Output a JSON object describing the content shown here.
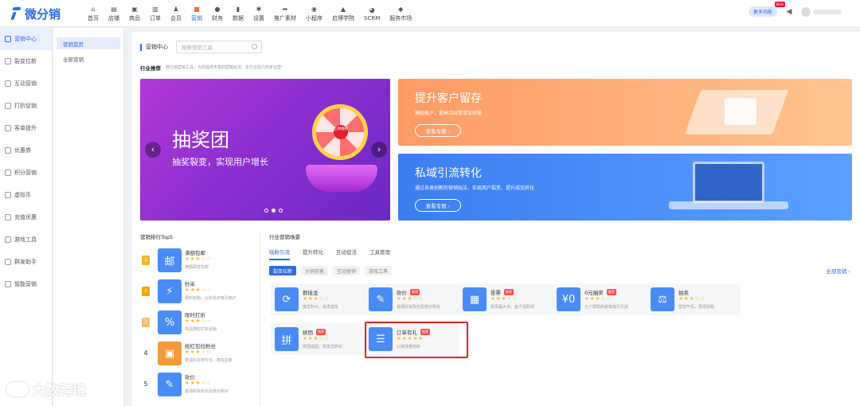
{
  "brand": {
    "logo_text": "微分销"
  },
  "top_nav": [
    {
      "label": "首页",
      "icon": "home-icon",
      "glyph": "⌂"
    },
    {
      "label": "店铺",
      "icon": "store-icon",
      "glyph": "▤"
    },
    {
      "label": "商品",
      "icon": "goods-icon",
      "glyph": "▣"
    },
    {
      "label": "订单",
      "icon": "order-icon",
      "glyph": "▥"
    },
    {
      "label": "会员",
      "icon": "member-icon",
      "glyph": "♟"
    },
    {
      "label": "营销",
      "icon": "marketing-icon",
      "glyph": "■",
      "active": true
    },
    {
      "label": "财务",
      "icon": "finance-icon",
      "glyph": "●"
    },
    {
      "label": "数据",
      "icon": "data-icon",
      "glyph": "▮"
    },
    {
      "label": "设置",
      "icon": "settings-icon",
      "glyph": "✱"
    },
    {
      "label": "推广素材",
      "icon": "share-icon",
      "glyph": "➦"
    },
    {
      "label": "小程序",
      "icon": "miniapp-icon",
      "glyph": "◉"
    },
    {
      "label": "启博学院",
      "icon": "academy-icon",
      "glyph": "▲"
    },
    {
      "label": "SCRM",
      "icon": "scrm-icon",
      "glyph": "◕"
    },
    {
      "label": "服务市场",
      "icon": "service-market-icon",
      "glyph": "◆"
    }
  ],
  "top_right": {
    "more_label": "更多功能",
    "new_badge": "NEW"
  },
  "sidebar": [
    {
      "label": "营销中心",
      "active": true
    },
    {
      "label": "裂变拉新"
    },
    {
      "label": "互动营销"
    },
    {
      "label": "打折促销"
    },
    {
      "label": "客单提升"
    },
    {
      "label": "优惠券"
    },
    {
      "label": "积分营销"
    },
    {
      "label": "虚拟币"
    },
    {
      "label": "充值优惠"
    },
    {
      "label": "游戏工具"
    },
    {
      "label": "群发助手"
    },
    {
      "label": "智能营销"
    }
  ],
  "subnav": [
    {
      "label": "营销首页",
      "active": true
    },
    {
      "label": "全部营销"
    }
  ],
  "header": {
    "title": "营销中心",
    "search_placeholder": "搜索营销工具"
  },
  "recommend": {
    "title": "行业推荐",
    "subtitle": "微分销营销工具，为您提供丰富的营销玩法，全方位助力商家运营!"
  },
  "banner_main": {
    "title": "抽奖团",
    "subtitle": "抽奖裂变，实现用户增长",
    "wheel_text": "立即抽奖"
  },
  "banner_r1": {
    "title": "提升客户留存",
    "subtitle": "激励客户，提高活跃度增加销量",
    "button": "查看专题 ›"
  },
  "banner_r2": {
    "title": "私域引流转化",
    "subtitle": "通过各类创新的营销玩法，实现用户裂变，提升成交转化",
    "button": "查看专题 ›"
  },
  "ranking": {
    "title": "营销排行Top5",
    "items": [
      {
        "rank": "1",
        "name": "满额包邮",
        "stars": "★★★☆☆",
        "desc": "满额即享包邮",
        "icon": "邮"
      },
      {
        "rank": "2",
        "name": "秒杀",
        "stars": "★★★☆☆",
        "desc": "限时抢购，以秒杀价吸引用户",
        "icon": "⚡"
      },
      {
        "rank": "3",
        "name": "限时打折",
        "stars": "★★★☆☆",
        "desc": "商品限时打折促销",
        "icon": "%"
      },
      {
        "rank": "4",
        "name": "抢红包拉粉丝",
        "stars": "★★★☆☆",
        "desc": "邀请好友抢红包，疯狂拉新",
        "icon": "▣"
      },
      {
        "rank": "5",
        "name": "砍价",
        "stars": "★★★☆☆",
        "desc": "邀请好友砍价后低价购买",
        "icon": "✎"
      }
    ]
  },
  "scenes": {
    "title": "行业营销场景",
    "tabs": [
      "吸粉引流",
      "提升转化",
      "互动促活",
      "工具管理"
    ],
    "chips": [
      "裂变拉新",
      "分销获客",
      "互动营销",
      "游戏工具"
    ],
    "all_link": "全部营销 ›",
    "cards": [
      {
        "name": "群接龙",
        "hot": "",
        "stars": "★★★☆☆",
        "desc": "接龙购买，激发成单",
        "icon": "⟳"
      },
      {
        "name": "砍价",
        "hot": "推荐",
        "stars": "★★★☆☆",
        "desc": "邀请好友砍价后低价购买",
        "icon": "✎"
      },
      {
        "name": "投票",
        "hot": "推荐",
        "stars": "★★★☆☆",
        "desc": "投票赢大奖，客户活跃高",
        "icon": "▦"
      },
      {
        "name": "0元抽奖",
        "hot": "推荐",
        "stars": "★★★☆☆",
        "desc": "为了帮助商家来吸引引流",
        "icon": "¥0"
      },
      {
        "name": "拍卖",
        "hot": "",
        "stars": "★★★☆☆",
        "desc": "营造气氛，围观拍租",
        "icon": "⚖"
      },
      {
        "name": "拼团",
        "hot": "推荐",
        "stars": "★★★☆☆",
        "desc": "拼团成团，裂变式转化",
        "icon": "拼"
      },
      {
        "name": "订单有礼",
        "hot": "推荐",
        "stars": "★★★★★",
        "desc": "公域流量拓新",
        "icon": "☰"
      }
    ]
  },
  "watermark": {
    "text": "大数跨境"
  },
  "colors": {
    "primary": "#2f6bdb",
    "highlight": "#e0211c",
    "banner_main": "#8a2ed0",
    "banner_r1": "#ff9a64",
    "banner_r2": "#3b7df0"
  }
}
